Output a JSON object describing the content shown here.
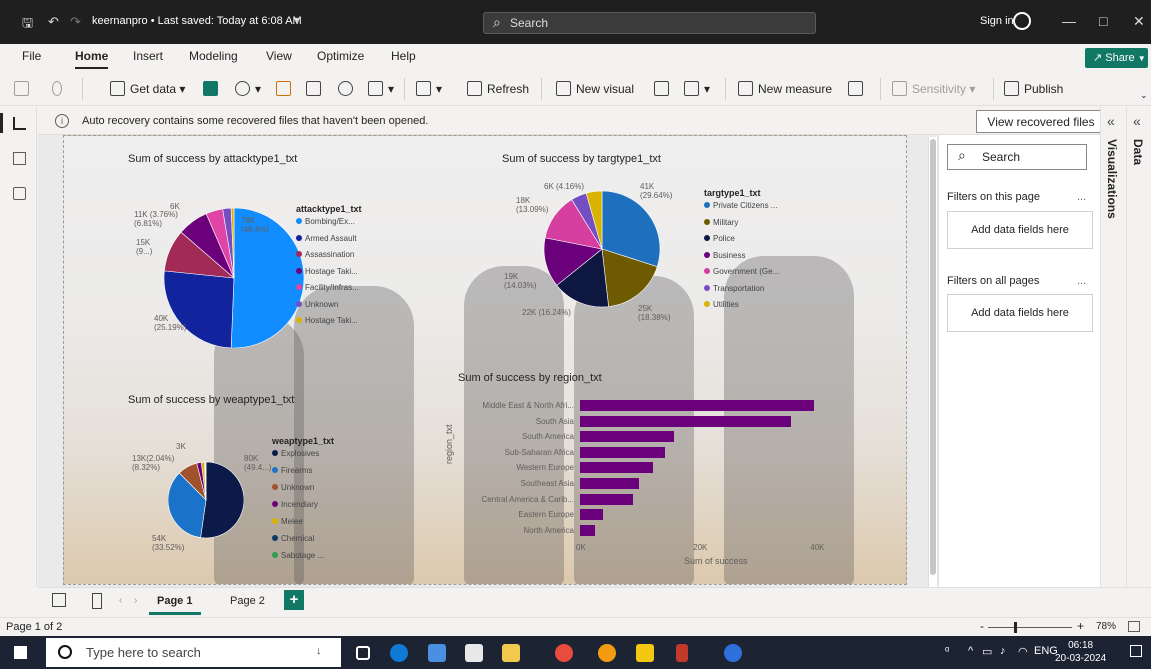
{
  "titlebar": {
    "title": "keernanpro • Last saved: Today at 6:08 AM",
    "search_placeholder": "Search",
    "sign_in": "Sign in"
  },
  "menu": {
    "items": [
      "File",
      "Home",
      "Insert",
      "Modeling",
      "View",
      "Optimize",
      "Help"
    ],
    "active": "Home",
    "share": "Share"
  },
  "ribbon": {
    "get_data": "Get data",
    "refresh": "Refresh",
    "new_visual": "New visual",
    "new_measure": "New measure",
    "sensitivity": "Sensitivity",
    "publish": "Publish"
  },
  "notification": {
    "text": "Auto recovery contains some recovered files that haven't been opened.",
    "button": "View recovered files"
  },
  "filters": {
    "search_placeholder": "Search",
    "on_this_page": "Filters on this page",
    "on_all_pages": "Filters on all pages",
    "drop_text": "Add data fields here",
    "more": "..."
  },
  "panes": {
    "visualizations": "Visualizations",
    "data": "Data"
  },
  "pages": {
    "tabs": [
      "Page 1",
      "Page 2"
    ],
    "active": "Page 1"
  },
  "status": {
    "page_info": "Page 1 of 2",
    "zoom": "78%"
  },
  "taskbar": {
    "search_placeholder": "Type here to search",
    "lang": "ENG",
    "time": "06:18",
    "date": "20-03-2024"
  },
  "chart_data": [
    {
      "type": "pie",
      "title": "Sum of success by attacktype1_txt",
      "legend_title": "attacktype1_txt",
      "legend": [
        "Bombing/Ex...",
        "Armed Assault",
        "Assassination",
        "Hostage Taki...",
        "Facility/Infras...",
        "Unknown",
        "Hostage Taki..."
      ],
      "values": [
        78,
        40,
        15,
        11,
        6,
        3,
        1
      ],
      "colors": [
        "#118dff",
        "#12239e",
        "#a12a56",
        "#6b007b",
        "#e044a7",
        "#744ec2",
        "#d9b300"
      ],
      "labels": [
        "78K\n(48.4%)",
        "40K\n(25.19%)",
        "15K\n(9...)",
        "11K (3.76%)\n(6.81%)",
        "6K",
        "",
        ""
      ]
    },
    {
      "type": "pie",
      "title": "Sum of success by targtype1_txt",
      "legend_title": "targtype1_txt",
      "legend": [
        "Private Citizens ...",
        "Military",
        "Police",
        "Business",
        "Government (Ge...",
        "Transportation",
        "Utilities"
      ],
      "values": [
        41,
        25,
        22,
        19,
        18,
        6,
        6
      ],
      "colors": [
        "#1f6fbf",
        "#6e5a00",
        "#0d1740",
        "#6b007b",
        "#d63ea0",
        "#744ec2",
        "#d9b300"
      ],
      "labels": [
        "41K\n(29.64%)",
        "25K\n(18.38%)",
        "22K (16.24%)",
        "19K\n(14.03%)",
        "18K\n(13.09%)",
        "6K (4.16%)",
        ""
      ]
    },
    {
      "type": "pie",
      "title": "Sum of success by weaptype1_txt",
      "legend_title": "weaptype1_txt",
      "legend": [
        "Explosives",
        "Firearms",
        "Unknown",
        "Incendiary",
        "Melee",
        "Chemical",
        "Sabotage ..."
      ],
      "values": [
        80,
        54,
        13,
        3,
        2,
        0.5,
        0.5
      ],
      "colors": [
        "#0b1a48",
        "#1a73c9",
        "#a0522d",
        "#6b007b",
        "#d9b300",
        "#0d3b66",
        "#2e9e4f"
      ],
      "labels": [
        "80K\n(49.4...)",
        "54K\n(33.52%)",
        "13K(2.04%)\n(8.32%)",
        "3K",
        "",
        "",
        ""
      ]
    },
    {
      "type": "bar",
      "title": "Sum of success by region_txt",
      "categories": [
        "Middle East & North Afri...",
        "South Asia",
        "South America",
        "Sub-Saharan Africa",
        "Western Europe",
        "Southeast Asia",
        "Central America & Carib...",
        "Eastern Europe",
        "North America"
      ],
      "values": [
        40,
        36,
        16,
        14.5,
        12.5,
        10,
        9,
        4,
        2.5
      ],
      "xlabel": "Sum of success",
      "ylabel": "region_txt",
      "xticks": [
        "0K",
        "20K",
        "40K"
      ],
      "xlim": [
        0,
        42
      ],
      "color": "#6b007b"
    }
  ]
}
